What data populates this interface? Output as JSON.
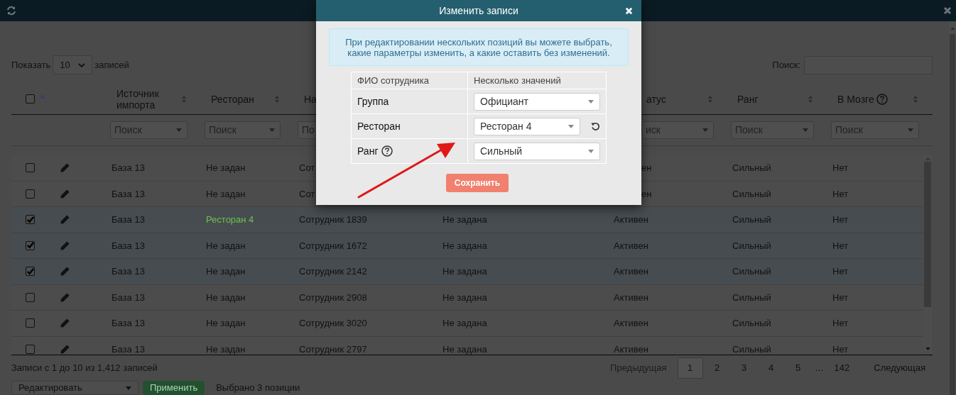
{
  "length_control": {
    "label_before": "Показать",
    "value": "10",
    "label_after": "записей"
  },
  "search": {
    "label": "Поиск:"
  },
  "table": {
    "select_all": {
      "checked": false
    },
    "columns": [
      {
        "label": "Источник импорта",
        "filter": "Поиск"
      },
      {
        "label": "Ресторан",
        "filter": "Поиск"
      },
      {
        "label": "На",
        "filter": "По"
      },
      {},
      {
        "label": "атус",
        "filter": "иск"
      },
      {
        "label": "Ранг",
        "filter": "Поиск"
      },
      {
        "label": "В Мозге",
        "filter": "Поиск",
        "help": true
      }
    ],
    "rows": [
      {
        "checked": false,
        "changed": false,
        "cells": [
          "База 13",
          "Не задан",
          "Сот",
          null,
          "ен",
          "Сильный",
          "Нет"
        ]
      },
      {
        "checked": false,
        "changed": false,
        "cells": [
          "База 13",
          "Не задан",
          "Сот",
          null,
          "ен",
          "Сильный",
          "Нет"
        ]
      },
      {
        "checked": true,
        "changed": true,
        "cells": [
          "База 13",
          "Ресторан 4",
          "Сотрудник 1839",
          "Не задана",
          "Активен",
          "Сильный",
          "Нет"
        ]
      },
      {
        "checked": true,
        "changed": false,
        "cells": [
          "База 13",
          "Не задан",
          "Сотрудник 1672",
          "Не задана",
          "Активен",
          "Сильный",
          "Нет"
        ]
      },
      {
        "checked": true,
        "changed": false,
        "cells": [
          "База 13",
          "Не задан",
          "Сотрудник 2142",
          "Не задана",
          "Активен",
          "Сильный",
          "Нет"
        ]
      },
      {
        "checked": false,
        "changed": false,
        "cells": [
          "База 13",
          "Не задан",
          "Сотрудник 2908",
          "Не задана",
          "Активен",
          "Сильный",
          "Нет"
        ]
      },
      {
        "checked": false,
        "changed": false,
        "cells": [
          "База 13",
          "Не задан",
          "Сотрудник 3020",
          "Не задана",
          "Активен",
          "Сильный",
          "Нет"
        ]
      },
      {
        "checked": false,
        "changed": false,
        "cells": [
          "База 13",
          "Не задан",
          "Сотрудник 2797",
          "Не задана",
          "Активен",
          "Сильный",
          "Нет"
        ]
      }
    ]
  },
  "footer": {
    "info": "Записи с 1 до 10 из 1,412 записей",
    "previous": "Предыдущая",
    "next": "Следующая",
    "pages": [
      {
        "label": "1",
        "kind": "page",
        "selected": true
      },
      {
        "label": "2",
        "kind": "page",
        "selected": false
      },
      {
        "label": "3",
        "kind": "page",
        "selected": false
      },
      {
        "label": "4",
        "kind": "page",
        "selected": false
      },
      {
        "label": "5",
        "kind": "page",
        "selected": false
      },
      {
        "label": "…",
        "kind": "gap"
      },
      {
        "label": "142",
        "kind": "page",
        "selected": false
      }
    ]
  },
  "bulk": {
    "action": "Редактировать",
    "apply_button": "Применить",
    "selection_info": "Выбрано 3 позиции"
  },
  "modal": {
    "title": "Изменить записи",
    "info": "При редактировании нескольких позиций вы можете выбрать, какие параметры изменить, а какие оставить без изменений.",
    "header": [
      "ФИО сотрудника",
      "Несколько значений"
    ],
    "rows": [
      {
        "label": "Группа",
        "value": "Официант",
        "help": false,
        "reset": false
      },
      {
        "label": "Ресторан",
        "value": "Ресторан 4",
        "help": false,
        "reset": true
      },
      {
        "label": "Ранг",
        "value": "Сильный",
        "help": true,
        "reset": false
      }
    ],
    "save_button": "Сохранить"
  }
}
